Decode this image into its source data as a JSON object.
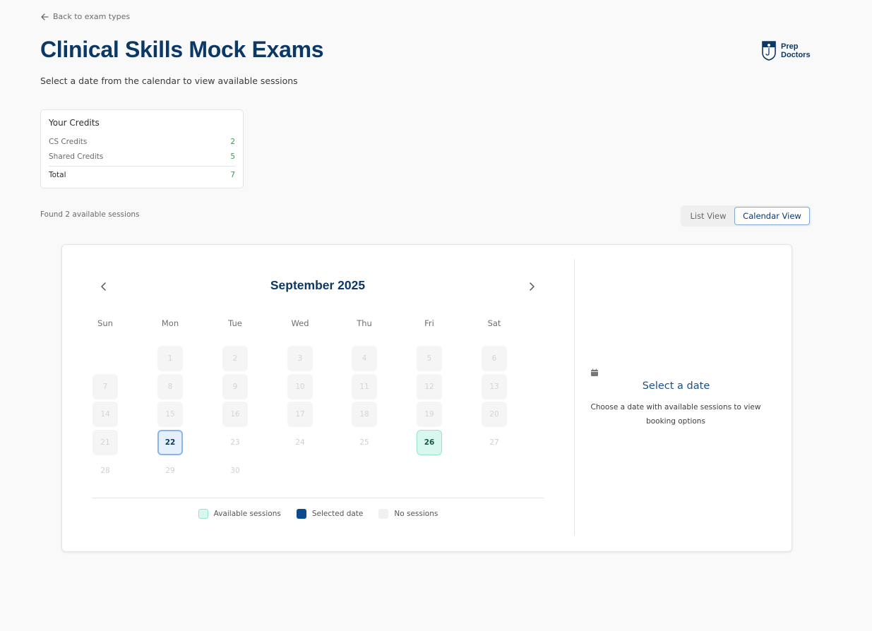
{
  "header": {
    "back_label": "Back to exam types",
    "title": "Clinical Skills Mock Exams",
    "subtitle": "Select a date from the calendar to view available sessions",
    "logo_line1": "Prep",
    "logo_line2": "Doctors"
  },
  "credits": {
    "title": "Your Credits",
    "rows": [
      {
        "label": "CS Credits",
        "value": "2"
      },
      {
        "label": "Shared Credits",
        "value": "5"
      }
    ],
    "total_label": "Total",
    "total_value": "7"
  },
  "results": {
    "found_text": "Found 2 available sessions"
  },
  "view_toggle": {
    "list_label": "List View",
    "calendar_label": "Calendar View",
    "active": "calendar"
  },
  "calendar": {
    "month_label": "September 2025",
    "weekdays": [
      "Sun",
      "Mon",
      "Tue",
      "Wed",
      "Thu",
      "Fri",
      "Sat"
    ],
    "first_weekday_index": 1,
    "days_in_month": 30,
    "past_through_day": 21,
    "selected_day": 22,
    "available_days": [
      26
    ]
  },
  "legend": {
    "available": "Available sessions",
    "selected": "Selected date",
    "none": "No sessions"
  },
  "side_panel": {
    "icon": "calendar-icon",
    "title": "Select a date",
    "description": "Choose a date with available sessions to view booking options"
  },
  "colors": {
    "brand": "#0c3866",
    "available_bg": "#d8f7ee",
    "selected_legend": "#0c4a8a",
    "no_sessions_bg": "#f0f0f0"
  }
}
